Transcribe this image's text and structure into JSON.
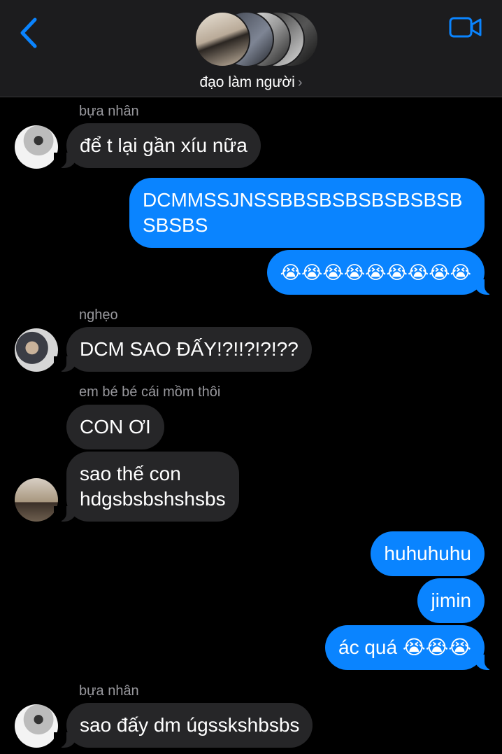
{
  "header": {
    "group_name": "đạo làm người",
    "chevron": "›",
    "back_icon": "chevron-left-icon",
    "video_icon": "video-camera-icon",
    "accent_color": "#0a84ff"
  },
  "messages": [
    {
      "sender": "bựa nhân"
    },
    {
      "text": "để t lại gần xíu nữa"
    },
    {
      "text": "DCMMSSJNSSBBSBSBSBSBSBSB\nSBSBS"
    },
    {
      "text": "😭😭😭😭😭😭😭😭😭"
    },
    {
      "sender": "nghẹo"
    },
    {
      "text": "DCM SAO ĐẤY!?!!?!?!??"
    },
    {
      "sender": "em bé bé cái mồm thôi"
    },
    {
      "text": "CON ƠI"
    },
    {
      "text": "sao thế con\nhdgsbsbshshsbs"
    },
    {
      "text": "huhuhuhu"
    },
    {
      "text": "jimin"
    },
    {
      "text": "ác quá 😭😭😭"
    },
    {
      "sender": "bựa nhân"
    },
    {
      "text": "sao đấy dm úgsskshbsbs"
    }
  ]
}
